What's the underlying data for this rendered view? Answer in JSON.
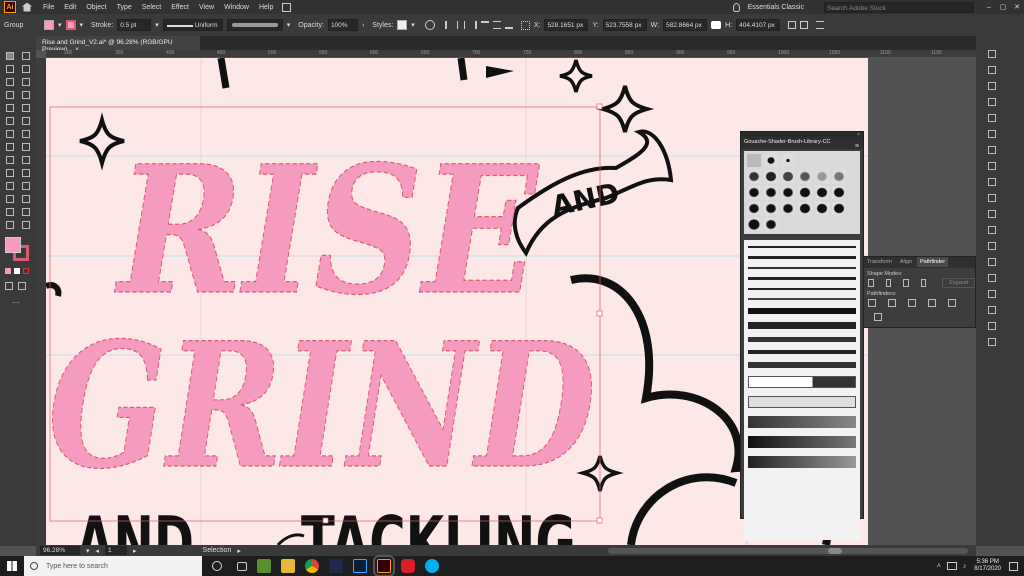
{
  "menubar": {
    "app_logo": "Ai",
    "items": [
      "File",
      "Edit",
      "Object",
      "Type",
      "Select",
      "Effect",
      "View",
      "Window",
      "Help"
    ],
    "workspace": "Essentials Classic",
    "search_placeholder": "Search Adobe Stock"
  },
  "control_bar": {
    "selection_type": "Group",
    "stroke_label": "Stroke:",
    "stroke_value": "0.5 pt",
    "profile_value": "Uniform",
    "opacity_label": "Opacity:",
    "opacity_value": "100%",
    "styles_label": "Styles:",
    "x_label": "X:",
    "x_value": "528.1651 px",
    "y_label": "Y:",
    "y_value": "523.7558 px",
    "w_label": "W:",
    "w_value": "582.8664 px",
    "h_label": "H:",
    "h_value": "404.4107 px",
    "fill_color": "#f59bc0"
  },
  "document": {
    "tab_title": "Rise and Grind_V2.ai* @ 96.28% (RGB/GPU Preview)",
    "close_glyph": "×",
    "ruler_ticks": [
      "300",
      "350",
      "400",
      "450",
      "500",
      "550",
      "600",
      "650",
      "700",
      "750",
      "800",
      "850",
      "900",
      "950",
      "1000",
      "1050",
      "1100",
      "1150"
    ]
  },
  "artwork": {
    "line1": "RISE",
    "line2": "GRIND",
    "line3a": "AND",
    "line3b": "TACKLING",
    "banner_text": "AND",
    "pink": "#f59bc0",
    "pink_stroke": "#e05a6f",
    "ink": "#111111",
    "background": "#fde8e8"
  },
  "brush_panel": {
    "title": "Gouache-Shader-Brush-Library-CC"
  },
  "pathfinder_panel": {
    "tabs": [
      "Transform",
      "Align",
      "Pathfinder"
    ],
    "active_tab": "Pathfinder",
    "shape_modes_label": "Shape Modes:",
    "expand_label": "Expand",
    "pathfinders_label": "Pathfinders:"
  },
  "statusbar": {
    "zoom": "96.28%",
    "artboard": "1",
    "tool": "Selection"
  },
  "taskbar": {
    "search_placeholder": "Type here to search",
    "time": "5:36 PM",
    "date": "8/17/2020"
  }
}
